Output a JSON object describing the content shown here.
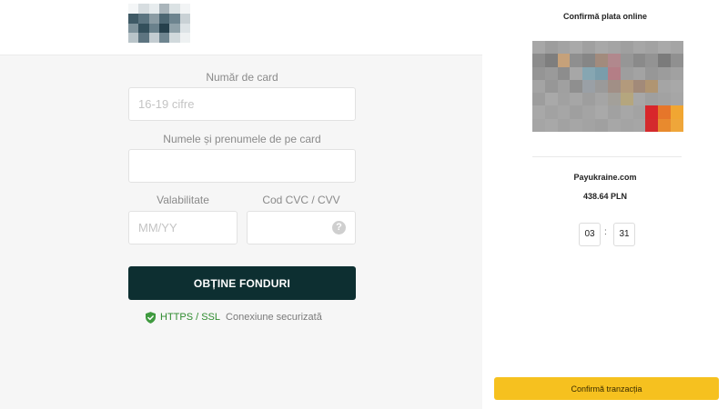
{
  "colors": {
    "primary_button": "#0d2f31",
    "confirm_button": "#f6c11f",
    "secure_green": "#2e8b2e",
    "pane_background": "#f6f6f6"
  },
  "header": {
    "logo_icon": "pixelated-logo-icon"
  },
  "form": {
    "card_number_label": "Număr de card",
    "card_number_placeholder": "16-19 cifre",
    "card_number_value": "",
    "name_label": "Numele și prenumele de pe card",
    "name_placeholder": "",
    "name_value": "",
    "expiry_label": "Valabilitate",
    "expiry_placeholder": "MM/YY",
    "expiry_value": "",
    "cvc_label": "Cod CVC / CVV",
    "cvc_placeholder": "",
    "cvc_value": "",
    "cvc_help_icon": "question-circle-icon",
    "cvc_help_glyph": "?",
    "submit_label": "OBȚINE FONDURI",
    "secure_icon": "shield-check-icon",
    "secure_protocol": "HTTPS / SSL",
    "secure_text": "Conexiune securizată"
  },
  "summary": {
    "title": "Confirmă plata online",
    "card_image_icon": "pixelated-card-image",
    "merchant": "Payukraine.com",
    "amount": "438.64 PLN",
    "timer_minutes": "03",
    "timer_separator": ":",
    "timer_seconds": "31",
    "confirm_label": "Confirmă tranzacția"
  }
}
